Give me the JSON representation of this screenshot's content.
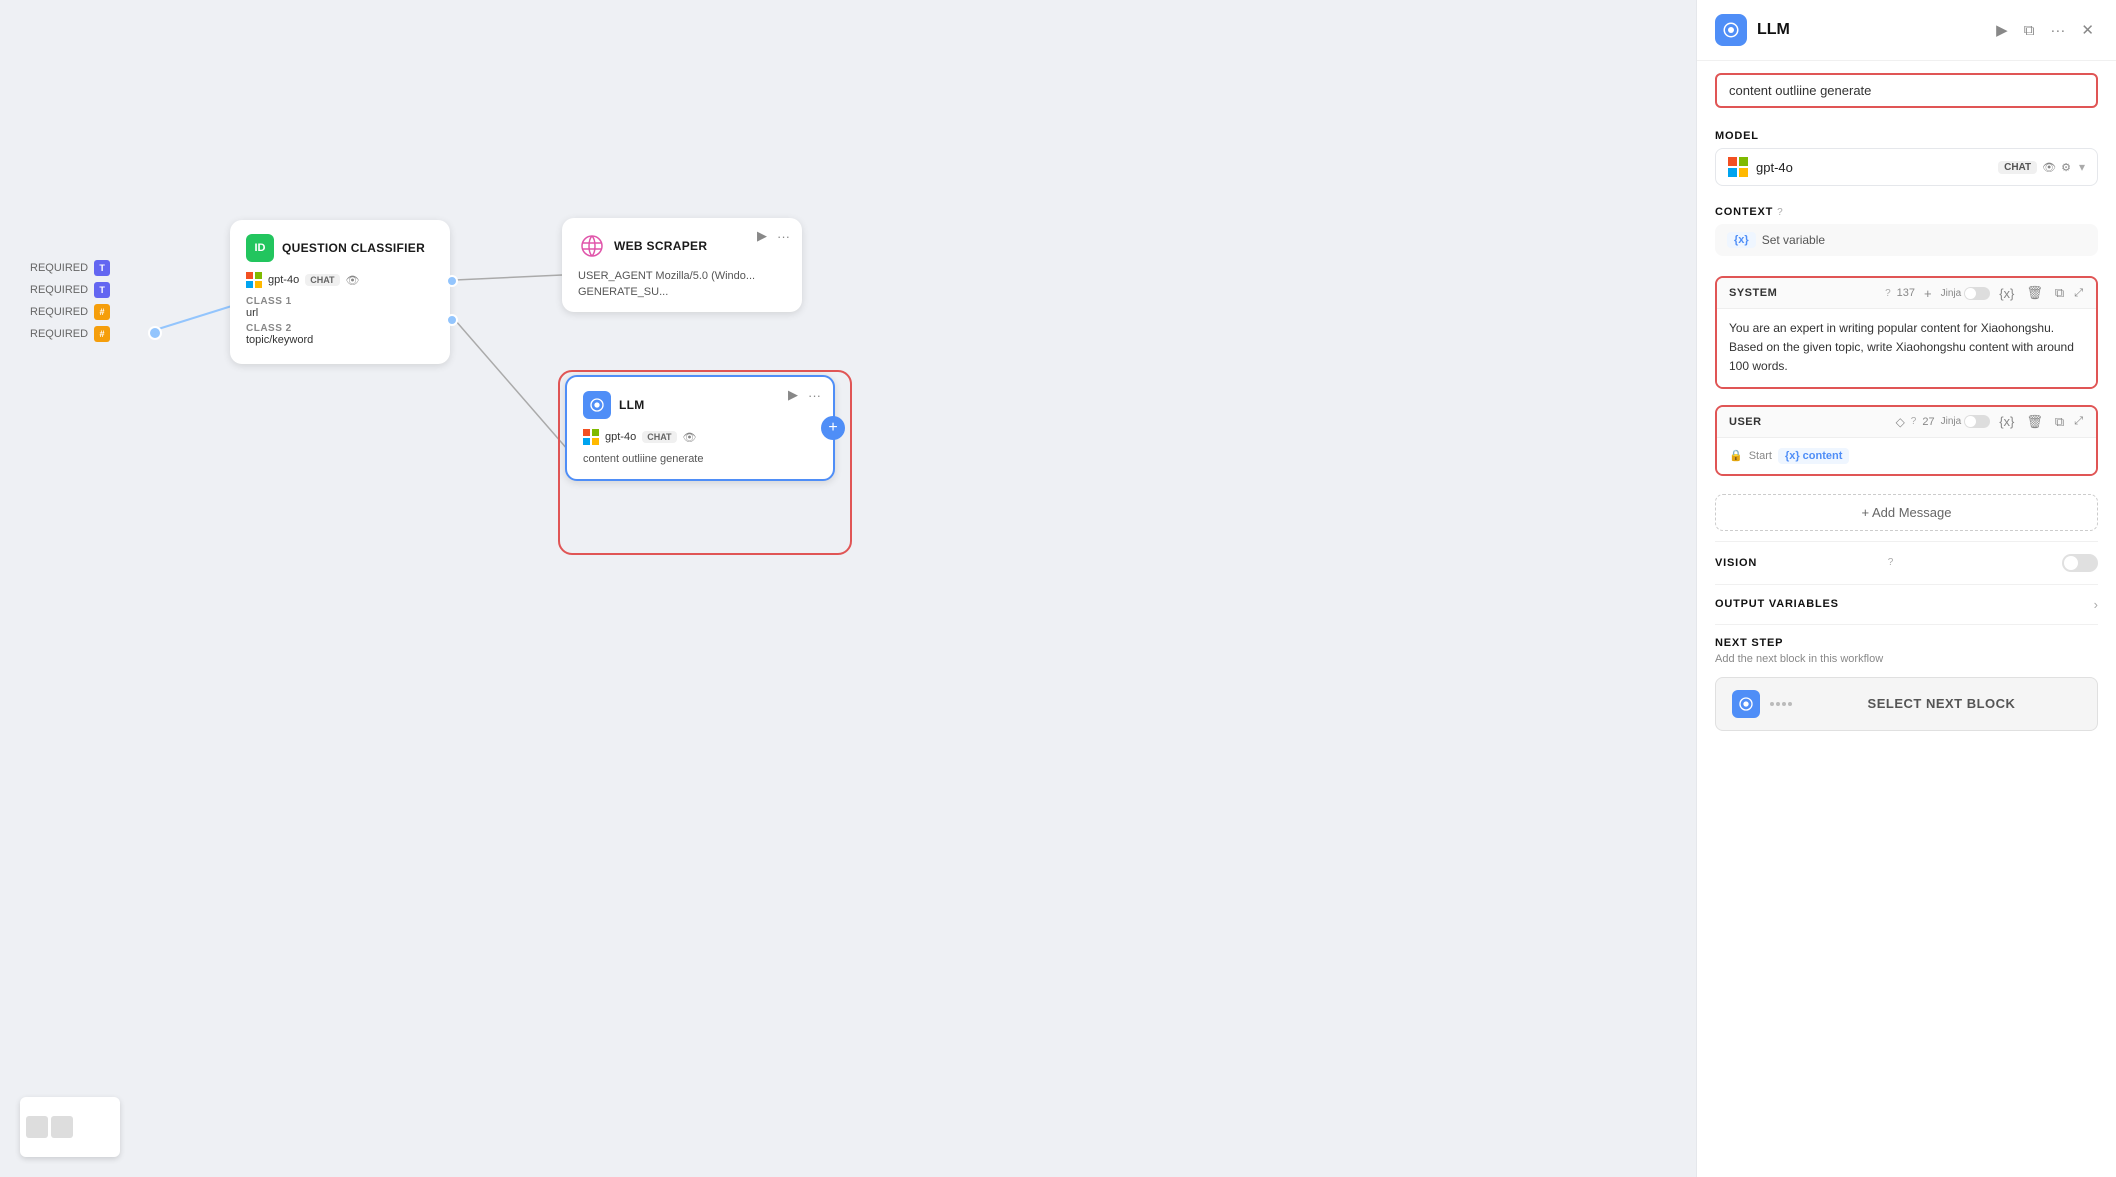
{
  "canvas": {
    "nodes": {
      "input": {
        "rows": [
          {
            "label": "REQUIRED",
            "badge": "T",
            "badge_type": "text"
          },
          {
            "label": "REQUIRED",
            "badge": "T",
            "badge_type": "text"
          },
          {
            "label": "REQUIRED",
            "badge": "#",
            "badge_type": "num"
          },
          {
            "label": "REQUIRED",
            "badge": "#",
            "badge_type": "num"
          }
        ]
      },
      "question_classifier": {
        "title": "QUESTION CLASSIFIER",
        "model": "gpt-4o",
        "model_badge": "CHAT",
        "class1_label": "CLASS 1",
        "class1_value": "url",
        "class2_label": "CLASS 2",
        "class2_value": "topic/keyword"
      },
      "web_scraper": {
        "title": "WEB SCRAPER",
        "line1": "USER_AGENT Mozilla/5.0 (Windo...",
        "line2": "GENERATE_SU..."
      },
      "llm_canvas": {
        "title": "LLM",
        "model": "gpt-4o",
        "model_badge": "CHAT",
        "description": "content outliine generate"
      }
    }
  },
  "panel": {
    "title": "LLM",
    "name_value": "content outliine generate",
    "model_section": {
      "label": "MODEL",
      "model_name": "gpt-4o",
      "chat_badge": "CHAT",
      "eye_label": "👁",
      "sliders_label": "⚙"
    },
    "context_section": {
      "label": "CONTEXT",
      "help": "?",
      "variable_label": "{x}",
      "set_variable": "Set variable"
    },
    "system_message": {
      "role": "SYSTEM",
      "help": "?",
      "char_count": "137",
      "plus_label": "+",
      "jinja_label": "Jinja",
      "var_label": "{x}",
      "delete_label": "🗑",
      "copy_label": "⧉",
      "expand_label": "⤢",
      "body": "You are an expert in writing popular content for Xiaohongshu.\nBased on the given topic, write Xiaohongshu content with around 100 words."
    },
    "user_message": {
      "role": "USER",
      "chevron": "◇",
      "help": "?",
      "char_count": "27",
      "jinja_label": "Jinja",
      "var_label": "{x}",
      "delete_label": "🗑",
      "copy_label": "⧉",
      "expand_label": "⤢",
      "lock_icon": "🔒",
      "start_label": "Start",
      "content_var": "{x} content"
    },
    "add_message_label": "+ Add Message",
    "vision_label": "VISION",
    "vision_help": "?",
    "output_vars_label": "OUTPUT VARIABLES",
    "next_step": {
      "title": "NEXT STEP",
      "subtitle": "Add the next block in this workflow",
      "button_label": "SELECT NEXT BLOCK"
    },
    "header_actions": {
      "play": "▶",
      "split": "⧉",
      "more": "···",
      "close": "✕"
    }
  }
}
